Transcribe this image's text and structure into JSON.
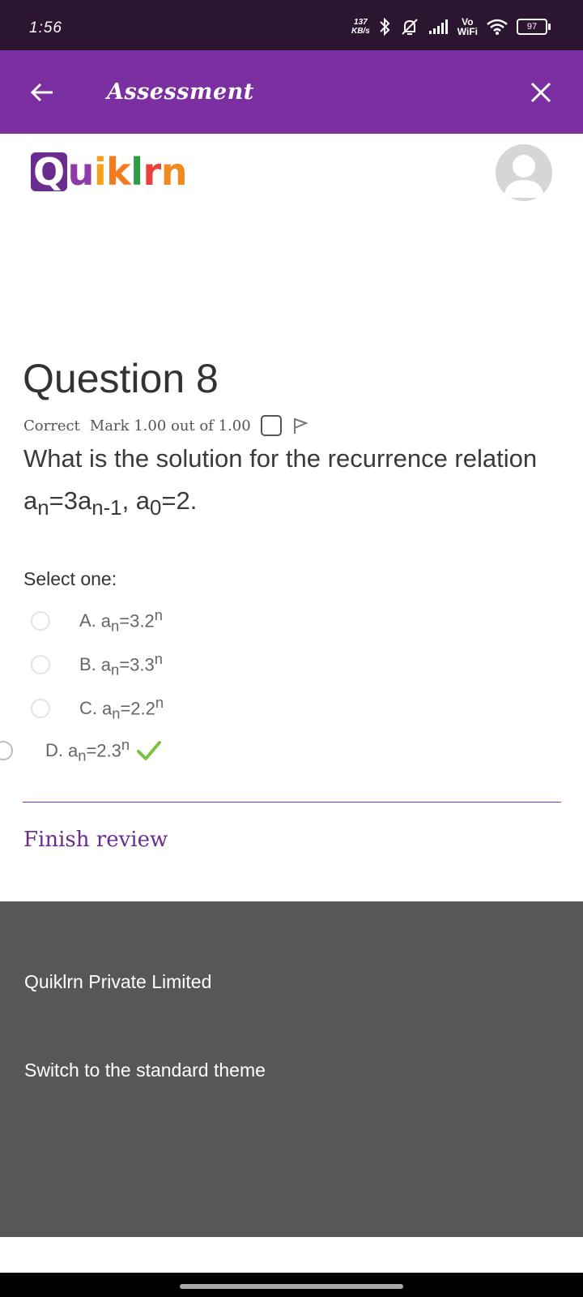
{
  "status_bar": {
    "time": "1:56",
    "net_speed_value": "137",
    "net_speed_unit": "KB/s",
    "vo_label": "Vo",
    "wifi_label": "WiFi",
    "battery": "97"
  },
  "app_bar": {
    "title": "Assessment",
    "back_icon": "arrow-left-icon",
    "close_icon": "close-icon",
    "background": "#7b2fa0"
  },
  "brand": {
    "logo_letters": [
      {
        "ch": "Q",
        "color": "#ffffff",
        "boxed": true
      },
      {
        "ch": "u",
        "color": "#8e3aa8",
        "boxed": false
      },
      {
        "ch": "i",
        "color": "#f4a21b",
        "boxed": false
      },
      {
        "ch": "k",
        "color": "#f47a20",
        "boxed": false
      },
      {
        "ch": "l",
        "color": "#2d9d46",
        "boxed": false
      },
      {
        "ch": "r",
        "color": "#e6423c",
        "boxed": false
      },
      {
        "ch": "n",
        "color": "#f08a1d",
        "boxed": false
      }
    ]
  },
  "question": {
    "title": "Question 8",
    "status": "Correct",
    "mark": "Mark 1.00 out of 1.00",
    "text": {
      "prefix": "What is the solution for the recurrence relation a",
      "sub1": "n",
      "mid1": "=3a",
      "sub2": "n-1",
      "mid2": ", a",
      "sub3": "0",
      "suffix": "=2."
    },
    "select_label": "Select one:",
    "options": [
      {
        "letter": "A.",
        "base": "a",
        "sub": "n",
        "eq": "=3.2",
        "sup": "n",
        "selected": false,
        "correct": false
      },
      {
        "letter": "B.",
        "base": "a",
        "sub": "n",
        "eq": "=3.3",
        "sup": "n",
        "selected": false,
        "correct": false
      },
      {
        "letter": "C.",
        "base": "a",
        "sub": "n",
        "eq": "=2.2",
        "sup": "n",
        "selected": false,
        "correct": false
      },
      {
        "letter": "D.",
        "base": "a",
        "sub": "n",
        "eq": "=2.3",
        "sup": "n",
        "selected": true,
        "correct": true
      }
    ],
    "check_color": "#7cc242"
  },
  "finish_review": "Finish review",
  "footer": {
    "company": "Quiklrn Private Limited",
    "theme_link": "Switch to the standard theme"
  }
}
